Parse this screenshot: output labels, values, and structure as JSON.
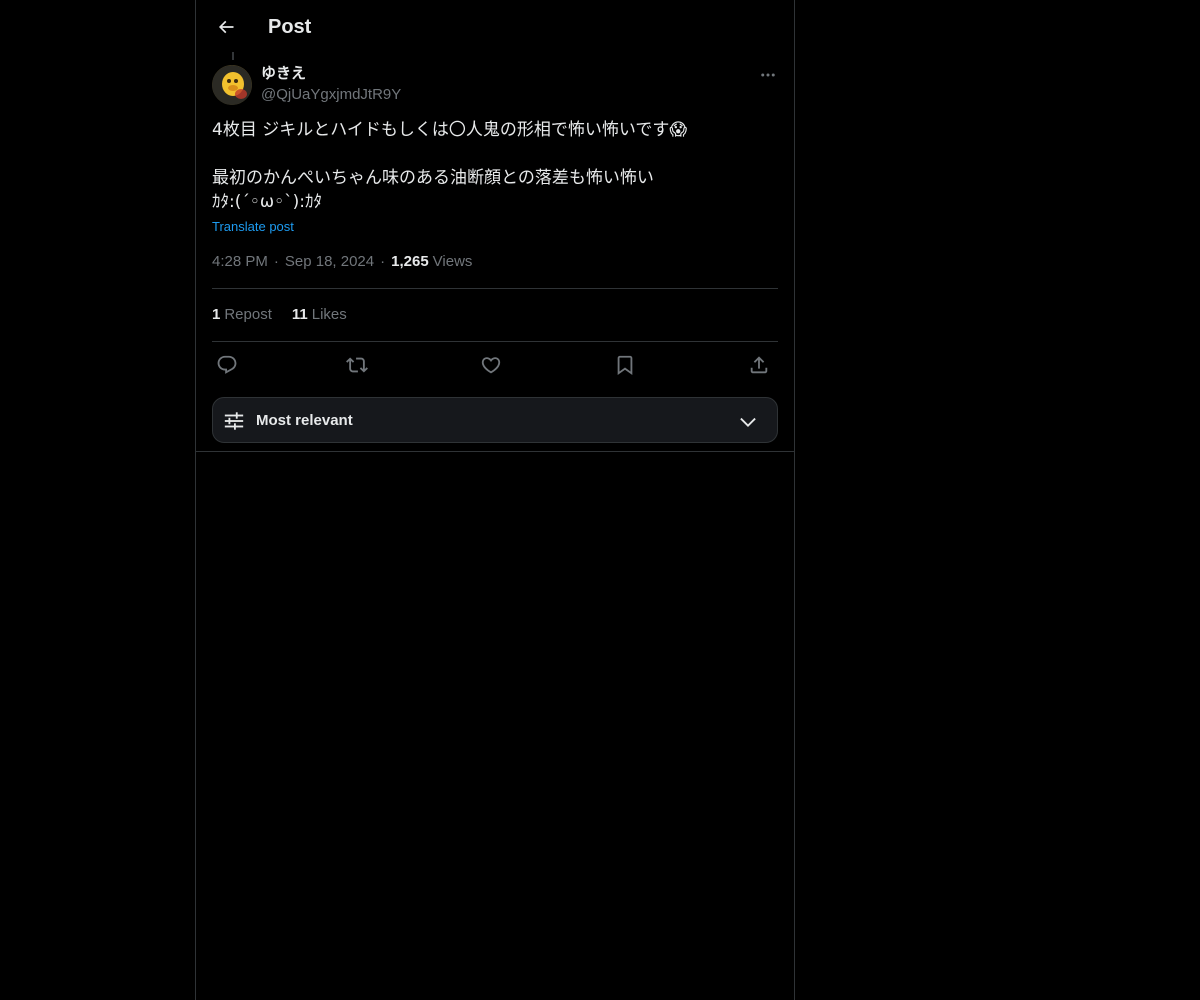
{
  "header": {
    "title": "Post",
    "back_icon": "arrow-left-icon"
  },
  "post": {
    "author": {
      "display_name": "ゆきえ",
      "handle": "@QjUaYgxjmdJtR9Y"
    },
    "text": "4枚目 ジキルとハイドもしくは〇人鬼の形相で怖い怖いです😱\n\n最初のかんぺいちゃん味のある油断顔との落差も怖い怖い\nｶﾀ:(´◦ω◦`):ｶﾀ",
    "translate_label": "Translate post",
    "time": "4:28 PM",
    "date": "Sep 18, 2024",
    "separator": "·",
    "views_count": "1,265",
    "views_label": "Views",
    "reposts_count": "1",
    "reposts_label": "Repost",
    "likes_count": "11",
    "likes_label": "Likes"
  },
  "actions": {
    "reply_icon": "reply-icon",
    "repost_icon": "repost-icon",
    "like_icon": "heart-icon",
    "bookmark_icon": "bookmark-icon",
    "share_icon": "share-icon"
  },
  "sort": {
    "label": "Most relevant",
    "icon": "sliders-icon",
    "chevron": "chevron-down-icon"
  },
  "colors": {
    "background": "#000000",
    "text_primary": "#e7e9ea",
    "text_secondary": "#71767b",
    "link": "#1d9bf0",
    "border": "#2f3336",
    "sort_bg": "#16181c"
  }
}
